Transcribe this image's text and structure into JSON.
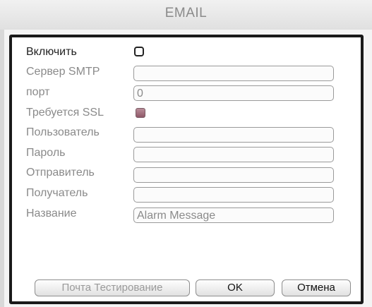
{
  "window": {
    "title": "EMAIL"
  },
  "form": {
    "enable_label": "Включить",
    "smtp_server_label": "Сервер SMTP",
    "smtp_server_value": "",
    "port_label": "порт",
    "port_value": "0",
    "ssl_label": "Требуется SSL",
    "ssl_checked": true,
    "user_label": "Пользователь",
    "user_value": "",
    "password_label": "Пароль",
    "password_value": "",
    "sender_label": "Отправитель",
    "sender_value": "",
    "recipient_label": "Получатель",
    "recipient_value": "",
    "subject_label": "Название",
    "subject_value": "Alarm Message"
  },
  "buttons": {
    "test_label": "Почта Тестирование",
    "ok_label": "OK",
    "cancel_label": "Отмена"
  },
  "colors": {
    "panel_border": "#1a1a1a",
    "label_gray": "#8a8a8a",
    "checkbox_checked": "#8f5868"
  }
}
